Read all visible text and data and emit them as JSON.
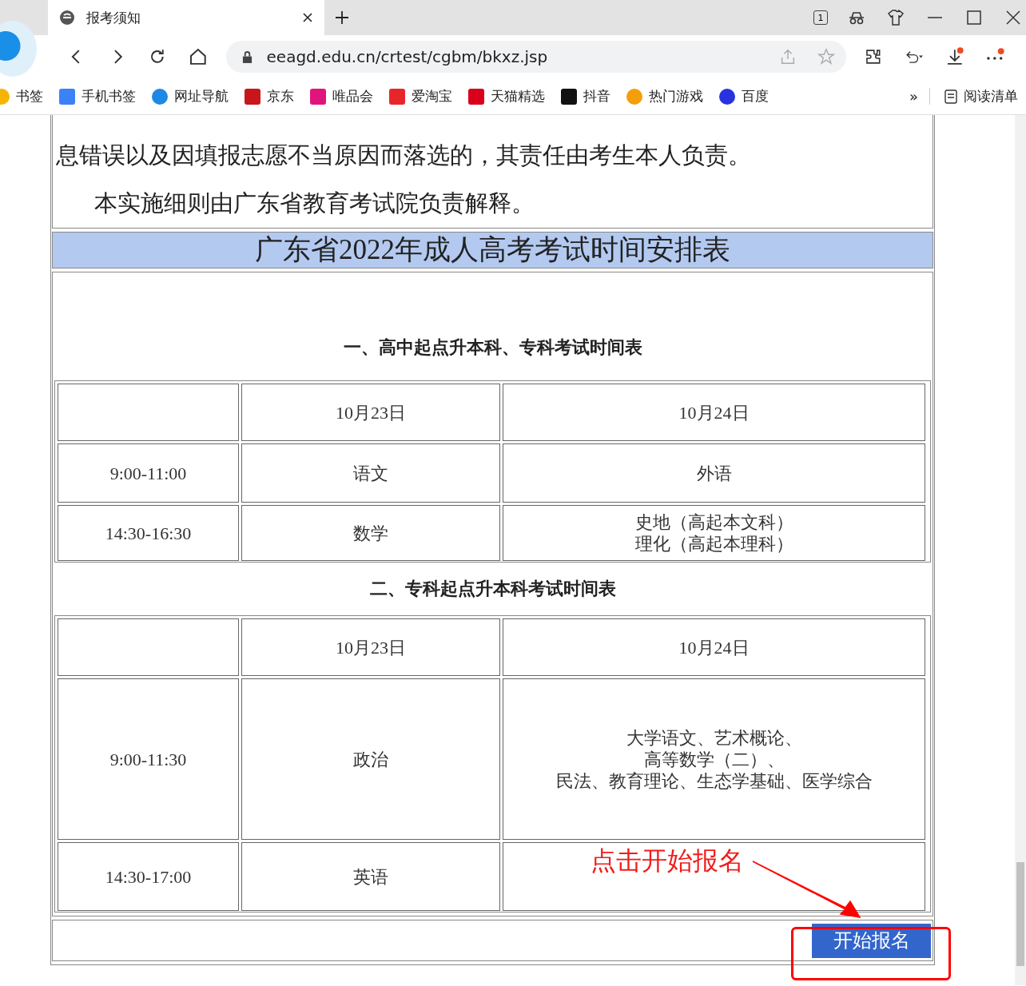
{
  "browser": {
    "tab_title": "报考须知",
    "url": "eeagd.edu.cn/crtest/cgbm/bkxz.jsp",
    "tab_count": "1",
    "bookmarks": [
      {
        "label": "书签",
        "kind": "star"
      },
      {
        "label": "手机书签",
        "kind": "phone"
      },
      {
        "label": "网址导航",
        "kind": "nav"
      },
      {
        "label": "京东",
        "kind": "jd"
      },
      {
        "label": "唯品会",
        "kind": "vip"
      },
      {
        "label": "爱淘宝",
        "kind": "taobao"
      },
      {
        "label": "天猫精选",
        "kind": "tmall"
      },
      {
        "label": "抖音",
        "kind": "douyin"
      },
      {
        "label": "热门游戏",
        "kind": "game"
      },
      {
        "label": "百度",
        "kind": "baidu"
      }
    ],
    "more": "»",
    "reading_list": "阅读清单"
  },
  "page": {
    "paragraphs": [
      {
        "text": "息错误以及因填报志愿不当原因而落选的，其责任由考生本人负责。",
        "indent": false
      },
      {
        "text": "本实施细则由广东省教育考试院负责解释。",
        "indent": true
      }
    ],
    "schedule_title": "广东省2022年成人高考考试时间安排表",
    "sections": [
      {
        "heading": "一、高中起点升本科、专科考试时间表",
        "rows": [
          [
            "",
            "10月23日",
            "10月24日"
          ],
          [
            "9:00-11:00",
            "语文",
            "外语"
          ],
          [
            "14:30-16:30",
            "数学",
            [
              "史地（高起本文科）",
              "理化（高起本理科）"
            ]
          ]
        ]
      },
      {
        "heading": "二、专科起点升本科考试时间表",
        "rows": [
          [
            "",
            "10月23日",
            "10月24日"
          ],
          [
            "9:00-11:30",
            "政治",
            [
              "大学语文、艺术概论、",
              "高等数学（二）、",
              "民法、教育理论、生态学基础、医学综合"
            ]
          ],
          [
            "14:30-17:00",
            "英语",
            ""
          ]
        ]
      }
    ],
    "annotation": "点击开始报名",
    "button": "开始报名"
  }
}
